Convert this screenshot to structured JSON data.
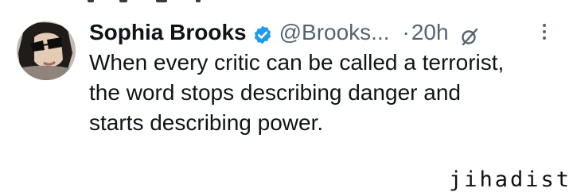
{
  "tweet": {
    "author_name": "Sophia Brooks",
    "handle": "@Brooks...",
    "separator": "·",
    "time": "20h",
    "verified_badge_icon": "verified-check-icon",
    "grok_icon": "grok-slash-icon",
    "more_icon": "vertical-dots-icon",
    "text_lines": [
      "When every critic can be called a terrorist,",
      "the word stops describing danger and",
      "starts describing power."
    ]
  },
  "watermark": "jihadist",
  "colors": {
    "text": "#0f1419",
    "secondary": "#536471",
    "verified": "#1d9bf0",
    "background": "#ffffff"
  }
}
